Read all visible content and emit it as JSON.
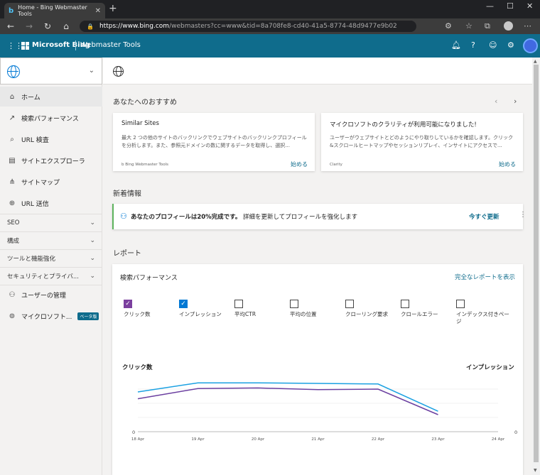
{
  "browser": {
    "tab_title": "Home - Bing Webmaster Tools",
    "tab_close": "✕",
    "new_tab": "+",
    "url_host": "https://www.bing.com",
    "url_rest": "/webmasters?cc=www&tid=8a708fe8-cd40-41a5-8774-48d9477e9b02",
    "min": "—",
    "max": "☐",
    "close": "✕"
  },
  "header": {
    "brand": "Microsoft Bing",
    "product": "Webmaster Tools"
  },
  "sidebar": {
    "items": [
      {
        "label": "ホーム",
        "icon": "⌂"
      },
      {
        "label": "検索パフォーマンス",
        "icon": "↗"
      },
      {
        "label": "URL 検査",
        "icon": "⌕"
      },
      {
        "label": "サイトエクスプローラ",
        "icon": "▤"
      },
      {
        "label": "サイトマップ",
        "icon": "⋔"
      },
      {
        "label": "URL 送信",
        "icon": "⊕"
      }
    ],
    "groups": [
      {
        "label": "SEO"
      },
      {
        "label": "構成"
      },
      {
        "label": "ツールと機能強化"
      },
      {
        "label": "セキュリティとプライバ..."
      }
    ],
    "user_mgmt": "ユーザーの管理",
    "microsoft_item": "マイクロソフト...",
    "beta": "ベータ版"
  },
  "recommend": {
    "title": "あなたへのおすすめ",
    "cards": [
      {
        "title": "Similar Sites",
        "body": "最大 2 つの他のサイトのバックリンクでウェブサイトのバックリンクプロフィールを分析します。また、参照元ドメインの数に関するデータを取得し、選択...",
        "source": "Bing Webmaster Tools",
        "action": "始める"
      },
      {
        "title": "マイクロソフトのクラリティが利用可能になりました!",
        "body": "ユーザーがウェブサイトとどのようにやり取りしているかを確認します。クリック&スクロールヒートマップやセッションリプレイ、インサイトにアクセスで...",
        "source": "Clarity",
        "action": "始める"
      }
    ]
  },
  "news": {
    "title": "新着情報",
    "bold": "あなたのプロフィールは20%完成です。",
    "text": "詳細を更新してプロフィールを強化します",
    "action": "今すぐ更新"
  },
  "reports": {
    "title": "レポート",
    "card_title": "検索パフォーマンス",
    "full_report": "完全なレポートを表示",
    "metrics": [
      {
        "label": "クリック数",
        "checked": true,
        "color": "#7b3f9e"
      },
      {
        "label": "インプレッション",
        "checked": true,
        "color": "#0078d4"
      },
      {
        "label": "平均CTR",
        "checked": false,
        "color": "#ffffff"
      },
      {
        "label": "平均の位置",
        "checked": false,
        "color": "#ffffff"
      },
      {
        "label": "クローリング要求",
        "checked": false,
        "color": "#ffffff"
      },
      {
        "label": "クロールエラー",
        "checked": false,
        "color": "#ffffff"
      },
      {
        "label": "インデックス付きページ",
        "checked": false,
        "color": "#ffffff"
      }
    ]
  },
  "chart_data": {
    "type": "line",
    "x": [
      "18 Apr",
      "19 Apr",
      "20 Apr",
      "21 Apr",
      "22 Apr",
      "23 Apr",
      "24 Apr"
    ],
    "left_axis_label": "クリック数",
    "right_axis_label": "インプレッション",
    "left_axis_min": "0",
    "right_axis_min": "0",
    "series": [
      {
        "name": "インプレッション",
        "color": "#1ba1e2",
        "values": [
          0.7,
          0.86,
          0.86,
          0.85,
          0.84,
          0.36,
          null
        ]
      },
      {
        "name": "クリック数",
        "color": "#6b3fa0",
        "values": [
          0.58,
          0.76,
          0.77,
          0.74,
          0.75,
          0.3,
          null
        ]
      }
    ],
    "ylim": [
      0,
      1
    ]
  }
}
